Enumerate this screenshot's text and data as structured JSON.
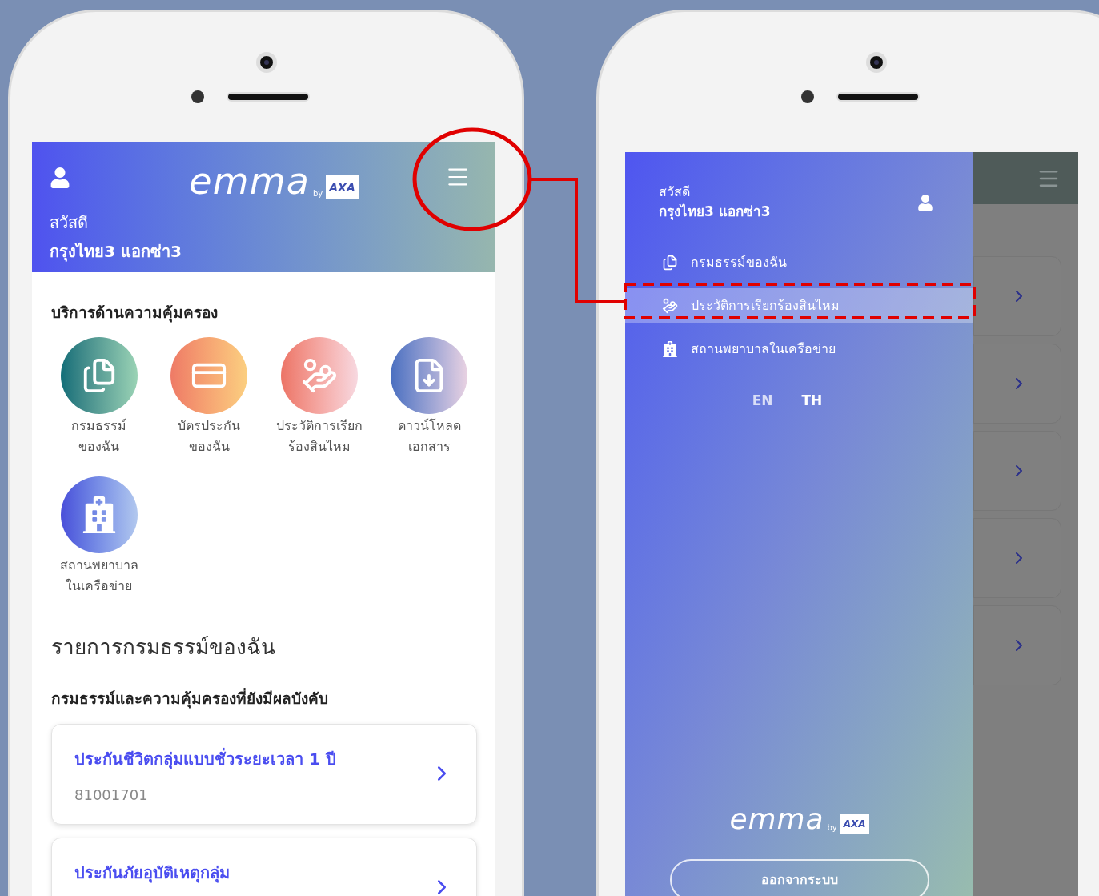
{
  "home_screen": {
    "header": {
      "greeting": "สวัสดี",
      "user_name": "กรุงไทย3 แอกซ่า3",
      "logo": {
        "wordmark": "emma",
        "by": "by",
        "brand": "AXA"
      }
    },
    "services_title": "บริการด้านความคุ้มครอง",
    "services": [
      {
        "kind": "policy",
        "label": "กรมธรรม์\nของฉัน"
      },
      {
        "kind": "card",
        "label": "บัตรประกัน\nของฉัน"
      },
      {
        "kind": "claim",
        "label": "ประวัติการเรียก\nร้องสินไหม"
      },
      {
        "kind": "download",
        "label": "ดาวน์โหลด\nเอกสาร"
      },
      {
        "kind": "hospital",
        "label": "สถานพยาบาล\nในเครือข่าย"
      }
    ],
    "policies_title": "รายการกรมธรรม์ของฉัน",
    "active_title": "กรมธรรม์และความคุ้มครองที่ยังมีผลบังคับ",
    "policies": [
      {
        "name": "ประกันชีวิตกลุ่มแบบชั่วระยะเวลา 1 ปี",
        "number": "81001701"
      },
      {
        "name": "ประกันภัยอุบัติเหตุกลุ่ม"
      }
    ]
  },
  "menu_screen": {
    "greeting": "สวัสดี",
    "user_name": "กรุงไทย3 แอกซ่า3",
    "items": [
      {
        "kind": "policy",
        "label": "กรมธรรม์ของฉัน",
        "selected": false
      },
      {
        "kind": "claim",
        "label": "ประวัติการเรียกร้องสินไหม",
        "selected": true
      },
      {
        "kind": "hospital",
        "label": "สถานพยาบาลในเครือข่าย",
        "selected": false
      }
    ],
    "languages": [
      {
        "label": "EN",
        "selected": false
      },
      {
        "label": "TH",
        "selected": true
      }
    ],
    "logo": {
      "wordmark": "emma",
      "by": "by",
      "brand": "AXA"
    },
    "logout": "ออกจากระบบ"
  }
}
